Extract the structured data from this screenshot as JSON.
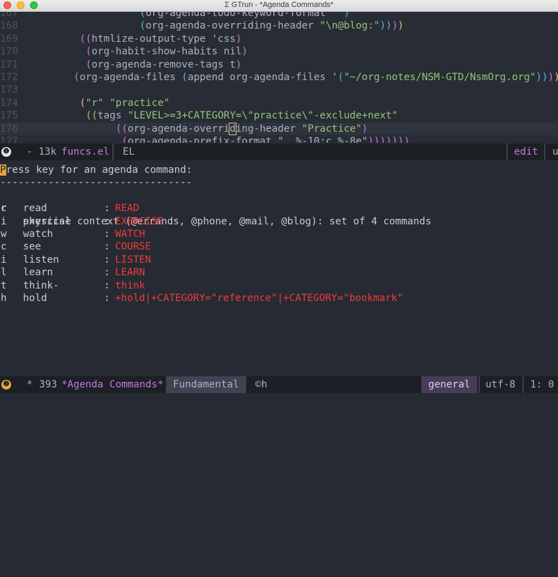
{
  "window": {
    "title": "Σ GTrun - *Agenda Commands*"
  },
  "code": {
    "lines": [
      {
        "num": "167",
        "indent": "                    ",
        "parts": [
          [
            "(",
            "p3"
          ],
          [
            "org-agenda-todo-keyword-format ",
            ""
          ],
          [
            "\"\"",
            "str"
          ],
          [
            ")",
            "p3"
          ]
        ]
      },
      {
        "num": "168",
        "indent": "                    ",
        "parts": [
          [
            "(",
            "p3"
          ],
          [
            "org-agenda-overriding-header ",
            ""
          ],
          [
            "\"\\n@blog:\"",
            "str"
          ],
          [
            ")",
            "p3"
          ],
          [
            ")",
            "p2"
          ],
          [
            ")",
            "p1"
          ],
          [
            ")",
            "p4"
          ]
        ]
      },
      {
        "num": "169",
        "indent": "          ",
        "parts": [
          [
            "((",
            "p1"
          ],
          [
            "htmlize-output-type 'css",
            ""
          ],
          [
            ")",
            "p1"
          ]
        ]
      },
      {
        "num": "170",
        "indent": "           ",
        "parts": [
          [
            "(",
            "p1"
          ],
          [
            "org-habit-show-habits nil",
            ""
          ],
          [
            ")",
            "p1"
          ]
        ]
      },
      {
        "num": "171",
        "indent": "           ",
        "parts": [
          [
            "(",
            "p1"
          ],
          [
            "org-agenda-remove-tags t",
            ""
          ],
          [
            ")",
            "p1"
          ]
        ]
      },
      {
        "num": "172",
        "indent": "         ",
        "parts": [
          [
            "(",
            "p1"
          ],
          [
            "org-agenda-files ",
            ""
          ],
          [
            "(",
            "p2"
          ],
          [
            "append org-agenda-files '",
            ""
          ],
          [
            "(",
            "p3"
          ],
          [
            "\"~/org-notes/NSM-GTD/NsmOrg.org\"",
            "str"
          ],
          [
            ")",
            "p3"
          ],
          [
            ")",
            "p2"
          ],
          [
            ")",
            "p1"
          ],
          [
            ")",
            "p4"
          ]
        ]
      },
      {
        "num": "173",
        "indent": "",
        "parts": []
      },
      {
        "num": "174",
        "indent": "          ",
        "parts": [
          [
            "(",
            "p4"
          ],
          [
            "\"r\" \"practice\"",
            "str"
          ]
        ]
      },
      {
        "num": "175",
        "indent": "           ",
        "parts": [
          [
            "((",
            "p5"
          ],
          [
            "tags ",
            ""
          ],
          [
            "\"LEVEL>=3+CATEGORY=\\\"practice\\\"-exclude+next\"",
            "str"
          ]
        ]
      },
      {
        "num": "176",
        "indent": "                ",
        "parts": [
          [
            "((",
            "p1"
          ],
          [
            "org-agenda-overri",
            ""
          ],
          [
            "d",
            "cursor-box"
          ],
          [
            "ing-header ",
            ""
          ],
          [
            "\"Practice\"",
            "str"
          ],
          [
            ")",
            "p1"
          ]
        ]
      },
      {
        "num": "177",
        "indent": "                 ",
        "parts": [
          [
            "(",
            "p1"
          ],
          [
            "org-agenda-prefix-format \"  %-10:c %-8e\"",
            ""
          ],
          [
            ")))))))",
            "p1"
          ]
        ]
      }
    ]
  },
  "modeline1": {
    "badge": "❶",
    "size": "- 13k",
    "file": "funcs.el",
    "lang": "EL",
    "state": "edit",
    "right_cut": "u"
  },
  "agenda": {
    "prompt_first": "P",
    "prompt_rest": "ress key for an agenda command:",
    "rule": "--------------------------------",
    "group": {
      "key": "c",
      "text": "physical context (@errands, @phone, @mail, @blog): set of 4 commands"
    },
    "commands": [
      {
        "key": "r",
        "name": "read",
        "value": "READ"
      },
      {
        "key": "i",
        "name": "exercise",
        "value": "EXERCISE"
      },
      {
        "key": "w",
        "name": "watch",
        "value": "WATCH"
      },
      {
        "key": "c",
        "name": "see",
        "value": "COURSE"
      },
      {
        "key": "i",
        "name": "listen",
        "value": "LISTEN"
      },
      {
        "key": "l",
        "name": "learn",
        "value": "LEARN"
      },
      {
        "key": "t",
        "name": "think-",
        "value": "think"
      },
      {
        "key": "h",
        "name": "hold",
        "value": "+hold|+CATEGORY=\"reference\"|+CATEGORY=\"bookmark\""
      }
    ],
    "colon": ":"
  },
  "modeline2": {
    "badge": "❷",
    "flags": "*",
    "lines": "393",
    "buffer": "*Agenda Commands*",
    "mode": "Fundamental",
    "minor": "©h",
    "workspace": "general",
    "encoding": "utf-8",
    "position": "1: 0"
  },
  "colors": {
    "background": "#262a33",
    "accent": "#c678dd",
    "command_value": "#ef3b3b",
    "cursor": "#e5a93a"
  }
}
